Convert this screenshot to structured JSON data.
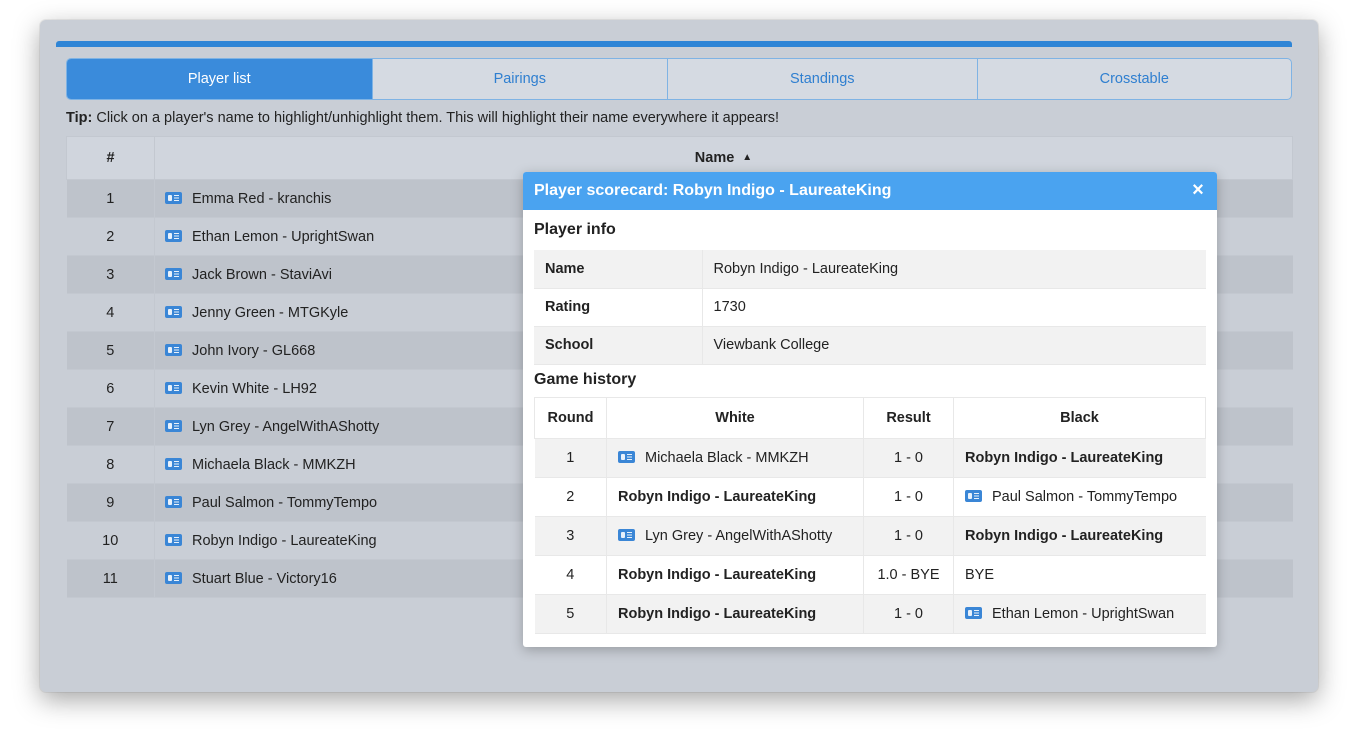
{
  "tabs": [
    {
      "label": "Player list",
      "active": true
    },
    {
      "label": "Pairings",
      "active": false
    },
    {
      "label": "Standings",
      "active": false
    },
    {
      "label": "Crosstable",
      "active": false
    }
  ],
  "tip": {
    "prefix": "Tip:",
    "text": " Click on a player's name to highlight/unhighlight them. This will highlight their name everywhere it appears!"
  },
  "player_table": {
    "headers": {
      "num": "#",
      "name": "Name",
      "sort_indicator": "▲"
    },
    "rows": [
      {
        "num": "1",
        "name": "Emma Red - kranchis"
      },
      {
        "num": "2",
        "name": "Ethan Lemon - UprightSwan"
      },
      {
        "num": "3",
        "name": "Jack Brown - StaviAvi"
      },
      {
        "num": "4",
        "name": "Jenny Green - MTGKyle"
      },
      {
        "num": "5",
        "name": "John Ivory - GL668"
      },
      {
        "num": "6",
        "name": "Kevin White - LH92"
      },
      {
        "num": "7",
        "name": "Lyn Grey - AngelWithAShotty"
      },
      {
        "num": "8",
        "name": "Michaela Black - MMKZH"
      },
      {
        "num": "9",
        "name": "Paul Salmon - TommyTempo"
      },
      {
        "num": "10",
        "name": "Robyn Indigo - LaureateKing"
      },
      {
        "num": "11",
        "name": "Stuart Blue - Victory16"
      }
    ]
  },
  "modal": {
    "title": "Player scorecard: Robyn Indigo - LaureateKing",
    "close_label": "×",
    "player_info_title": "Player info",
    "player_info": [
      {
        "key": "Name",
        "value": "Robyn Indigo - LaureateKing"
      },
      {
        "key": "Rating",
        "value": "1730"
      },
      {
        "key": "School",
        "value": "Viewbank College"
      }
    ],
    "game_history_title": "Game history",
    "game_headers": {
      "round": "Round",
      "white": "White",
      "result": "Result",
      "black": "Black"
    },
    "games": [
      {
        "round": "1",
        "white": "Michaela Black - MMKZH",
        "result": "1 - 0",
        "black": "Robyn Indigo - LaureateKing"
      },
      {
        "round": "2",
        "white": "Robyn Indigo - LaureateKing",
        "result": "1 - 0",
        "black": "Paul Salmon - TommyTempo"
      },
      {
        "round": "3",
        "white": "Lyn Grey - AngelWithAShotty",
        "result": "1 - 0",
        "black": "Robyn Indigo - LaureateKing"
      },
      {
        "round": "4",
        "white": "Robyn Indigo - LaureateKing",
        "result": "1.0 - BYE",
        "black": "BYE"
      },
      {
        "round": "5",
        "white": "Robyn Indigo - LaureateKing",
        "result": "1 - 0",
        "black": "Ethan Lemon - UprightSwan"
      }
    ]
  },
  "colors": {
    "accent": "#3a8bdb",
    "modal_header": "#4aa3f0",
    "backdrop": "#c9ced6"
  },
  "icons": {
    "player_card": "id-card-icon",
    "close": "close-icon",
    "sort": "sort-asc-icon"
  }
}
